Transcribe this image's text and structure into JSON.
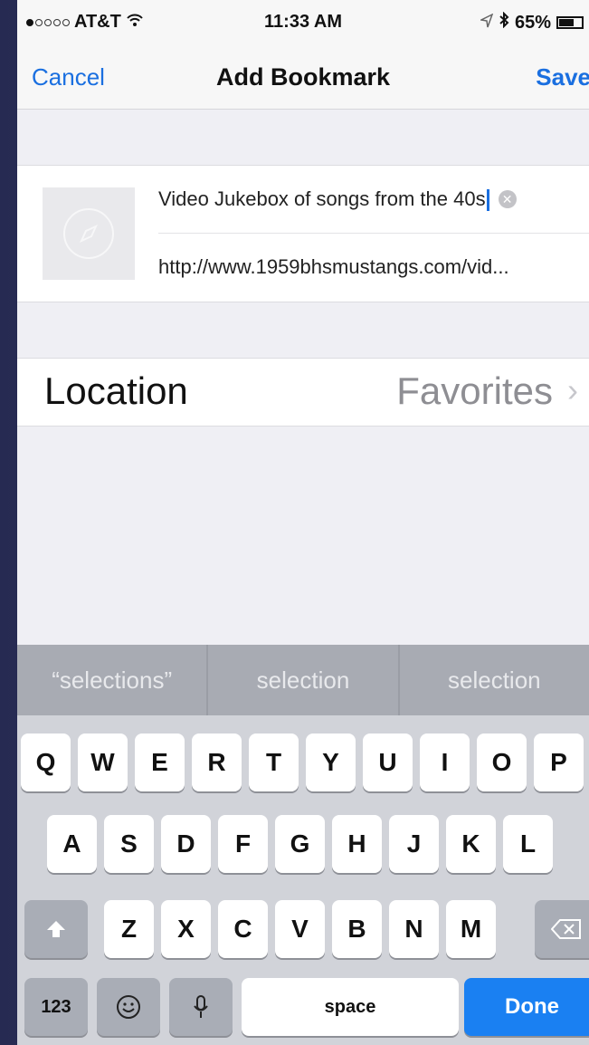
{
  "status_bar": {
    "carrier": "AT&T",
    "time": "11:33 AM",
    "battery": "65%",
    "battery_level": 0.65,
    "signal_bars_filled": 1,
    "signal_bars_total": 5
  },
  "nav": {
    "cancel_label": "Cancel",
    "title": "Add Bookmark",
    "save_label": "Save"
  },
  "bookmark": {
    "title_value": "Video Jukebox of songs from the 40s",
    "url_value": "http://www.1959bhsmustangs.com/vid..."
  },
  "location": {
    "label": "Location",
    "value": "Favorites"
  },
  "suggestions": [
    "“selections”",
    "selection",
    "selection"
  ],
  "keyboard": {
    "row1": [
      "Q",
      "W",
      "E",
      "R",
      "T",
      "Y",
      "U",
      "I",
      "O",
      "P"
    ],
    "row2": [
      "A",
      "S",
      "D",
      "F",
      "G",
      "H",
      "J",
      "K",
      "L"
    ],
    "row3": [
      "Z",
      "X",
      "C",
      "V",
      "B",
      "N",
      "M"
    ],
    "numbers_label": "123",
    "space_label": "space",
    "done_label": "Done"
  },
  "colors": {
    "accent": "#1a6fe0",
    "done_key": "#1a80f2",
    "background": "#efeff4",
    "suggestion_bar": "#a8abb3",
    "keyboard": "#d1d3d9"
  },
  "icons": [
    "wifi-icon",
    "location-arrow-icon",
    "bluetooth-icon",
    "battery-icon",
    "compass-icon",
    "clear-icon",
    "chevron-right-icon",
    "shift-icon",
    "backspace-icon",
    "emoji-icon",
    "microphone-icon"
  ]
}
